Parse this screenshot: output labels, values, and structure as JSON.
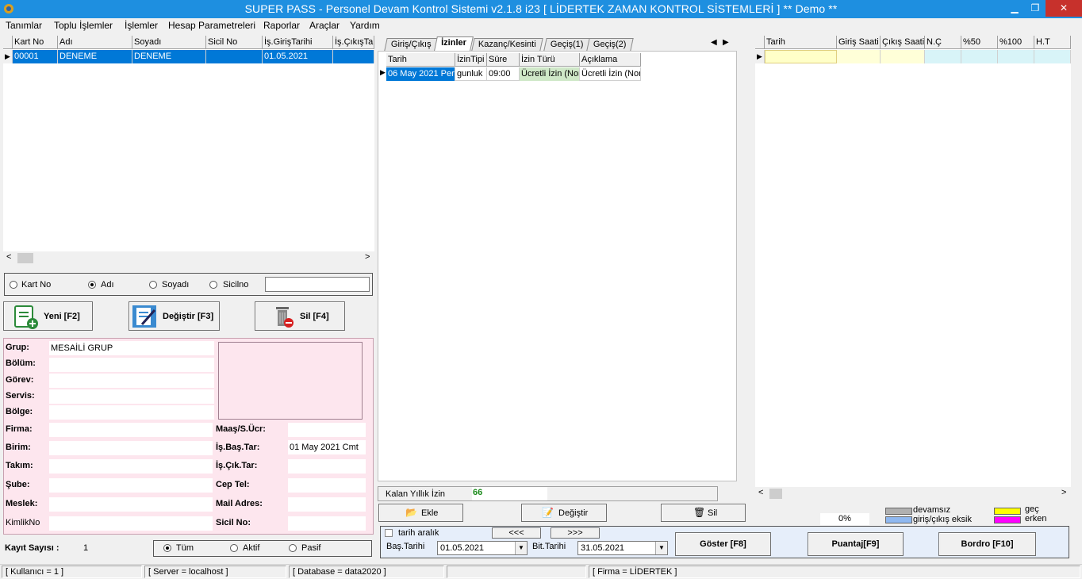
{
  "window": {
    "title": "SUPER PASS - Personel Devam Kontrol Sistemi v2.1.8 i23 [ LİDERTEK ZAMAN KONTROL  SİSTEMLERİ ]    ** Demo **",
    "min": "▁",
    "max": "❐",
    "close": "✕"
  },
  "menu": [
    "Tanımlar",
    "Toplu İşlemler",
    "İşlemler",
    "Hesap Parametreleri",
    "Raporlar",
    "Araçlar",
    "Yardım"
  ],
  "personnel_grid": {
    "headers": [
      "Kart No",
      "Adı",
      "Soyadı",
      "Sicil No",
      "İş.GirişTarihi",
      "İş.ÇıkışTarihi"
    ],
    "rows": [
      [
        "00001",
        "DENEME",
        "DENEME",
        "",
        "01.05.2021",
        ""
      ]
    ]
  },
  "search": {
    "options": [
      "Kart No",
      "Adı",
      "Soyadı",
      "Sicilno"
    ],
    "selected": "Adı",
    "value": ""
  },
  "buttons": {
    "new": "Yeni [F2]",
    "edit": "Değiştir [F3]",
    "delete": "Sil [F4]"
  },
  "details": {
    "labels": {
      "grup": "Grup:",
      "bolum": "Bölüm:",
      "gorev": "Görev:",
      "servis": "Servis:",
      "bolge": "Bölge:",
      "firma": "Firma:",
      "birim": "Birim:",
      "takim": "Takım:",
      "sube": "Şube:",
      "meslek": "Meslek:",
      "kimlik": "KimlikNo",
      "maas": "Maaş/S.Ücr:",
      "isbas": "İş.Baş.Tar:",
      "iscik": "İş.Çık.Tar:",
      "ceptel": "Cep Tel:",
      "mail": "Mail Adres:",
      "sicil": "Sicil No:"
    },
    "values": {
      "grup": "MESAİLİ GRUP",
      "isbas": "01 May 2021 Cmt"
    }
  },
  "footer_left": {
    "count_label": "Kayıt Sayısı :",
    "count": "1",
    "filters": [
      "Tüm",
      "Aktif",
      "Pasif"
    ],
    "filter_selected": "Tüm"
  },
  "tabs": [
    "Giriş/Çıkış",
    "İzinler",
    "Kazanç/Kesinti",
    "Geçiş(1)",
    "Geçiş(2)"
  ],
  "active_tab": "İzinler",
  "leave_grid": {
    "headers": [
      "Tarih",
      "İzinTipi",
      "Süre",
      "İzin Türü",
      "Açıklama"
    ],
    "rows": [
      [
        "06 May 2021 Per",
        "gunluk",
        "09:00",
        "Ücretli İzin (Nor",
        "Ücretli İzin (Nor"
      ]
    ]
  },
  "leave_balance": {
    "label": "Kalan Yıllık İzin",
    "value": "66"
  },
  "leave_buttons": {
    "add": "Ekle",
    "edit": "Değiştir",
    "delete": "Sil"
  },
  "date_range": {
    "check_label": "tarih aralık",
    "prev": "<<<",
    "next": ">>>",
    "start_label": "Baş.Tarihi",
    "start": "01.05.2021",
    "end_label": "Bit.Tarihi",
    "end": "31.05.2021"
  },
  "report_buttons": {
    "show": "Göster [F8]",
    "timesheet": "Puantaj[F9]",
    "payroll": "Bordro [F10]"
  },
  "attendance_grid": {
    "headers": [
      "Tarih",
      "Giriş Saati",
      "Çıkış Saati",
      "N.Ç",
      "%50",
      "%100",
      "H.T"
    ]
  },
  "legend": {
    "percent": "0%",
    "items": [
      {
        "label": "devamsız",
        "color": "#b0b0b0"
      },
      {
        "label": "giriş/çıkış eksik",
        "color": "#8fb8f0"
      },
      {
        "label": "geç",
        "color": "#ffff00"
      },
      {
        "label": "erken",
        "color": "#ff00ff"
      }
    ]
  },
  "status": [
    "[ Kullanıcı = 1 ]",
    "[ Server = localhost ]",
    "[ Database = data2020 ]",
    "",
    "[ Firma = LİDERTEK ]"
  ]
}
